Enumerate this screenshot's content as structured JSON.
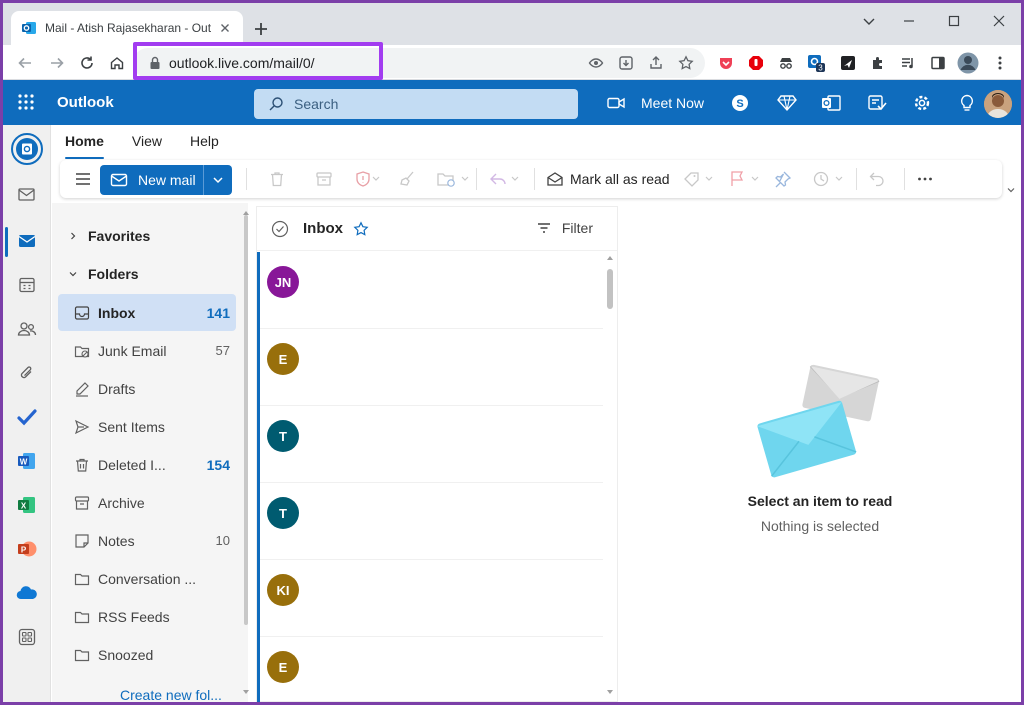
{
  "browser": {
    "tab_title": "Mail - Atish Rajasekharan - Outlook",
    "url": "outlook.live.com/mail/0/",
    "extension_badge": "3"
  },
  "header": {
    "app_name": "Outlook",
    "search_placeholder": "Search",
    "meet_now_label": "Meet Now",
    "brand_color": "#0f6cbd"
  },
  "ribbon": {
    "tabs": [
      {
        "label": "Home"
      },
      {
        "label": "View"
      },
      {
        "label": "Help"
      }
    ],
    "new_mail_label": "New mail",
    "mark_all_read_label": "Mark all as read"
  },
  "folders": {
    "favorites_label": "Favorites",
    "folders_label": "Folders",
    "items": [
      {
        "label": "Inbox",
        "count": "141",
        "icon": "inbox-icon"
      },
      {
        "label": "Junk Email",
        "count": "57",
        "icon": "junk-icon"
      },
      {
        "label": "Drafts",
        "count": "",
        "icon": "drafts-icon"
      },
      {
        "label": "Sent Items",
        "count": "",
        "icon": "sent-icon"
      },
      {
        "label": "Deleted I...",
        "count": "154",
        "icon": "trash-icon"
      },
      {
        "label": "Archive",
        "count": "",
        "icon": "archive-icon"
      },
      {
        "label": "Notes",
        "count": "10",
        "icon": "notes-icon"
      },
      {
        "label": "Conversation ...",
        "count": "",
        "icon": "folder-icon"
      },
      {
        "label": "RSS Feeds",
        "count": "",
        "icon": "folder-icon"
      },
      {
        "label": "Snoozed",
        "count": "",
        "icon": "folder-icon"
      }
    ],
    "create_new_folder_label": "Create new fol..."
  },
  "message_list": {
    "title": "Inbox",
    "filter_label": "Filter",
    "messages": [
      {
        "initials": "JN",
        "color": "#881798"
      },
      {
        "initials": "E",
        "color": "#986f0b"
      },
      {
        "initials": "T",
        "color": "#005b70"
      },
      {
        "initials": "T",
        "color": "#005b70"
      },
      {
        "initials": "KI",
        "color": "#986f0b"
      },
      {
        "initials": "E",
        "color": "#986f0b"
      }
    ]
  },
  "reading_pane": {
    "empty_title": "Select an item to read",
    "empty_subtitle": "Nothing is selected"
  }
}
